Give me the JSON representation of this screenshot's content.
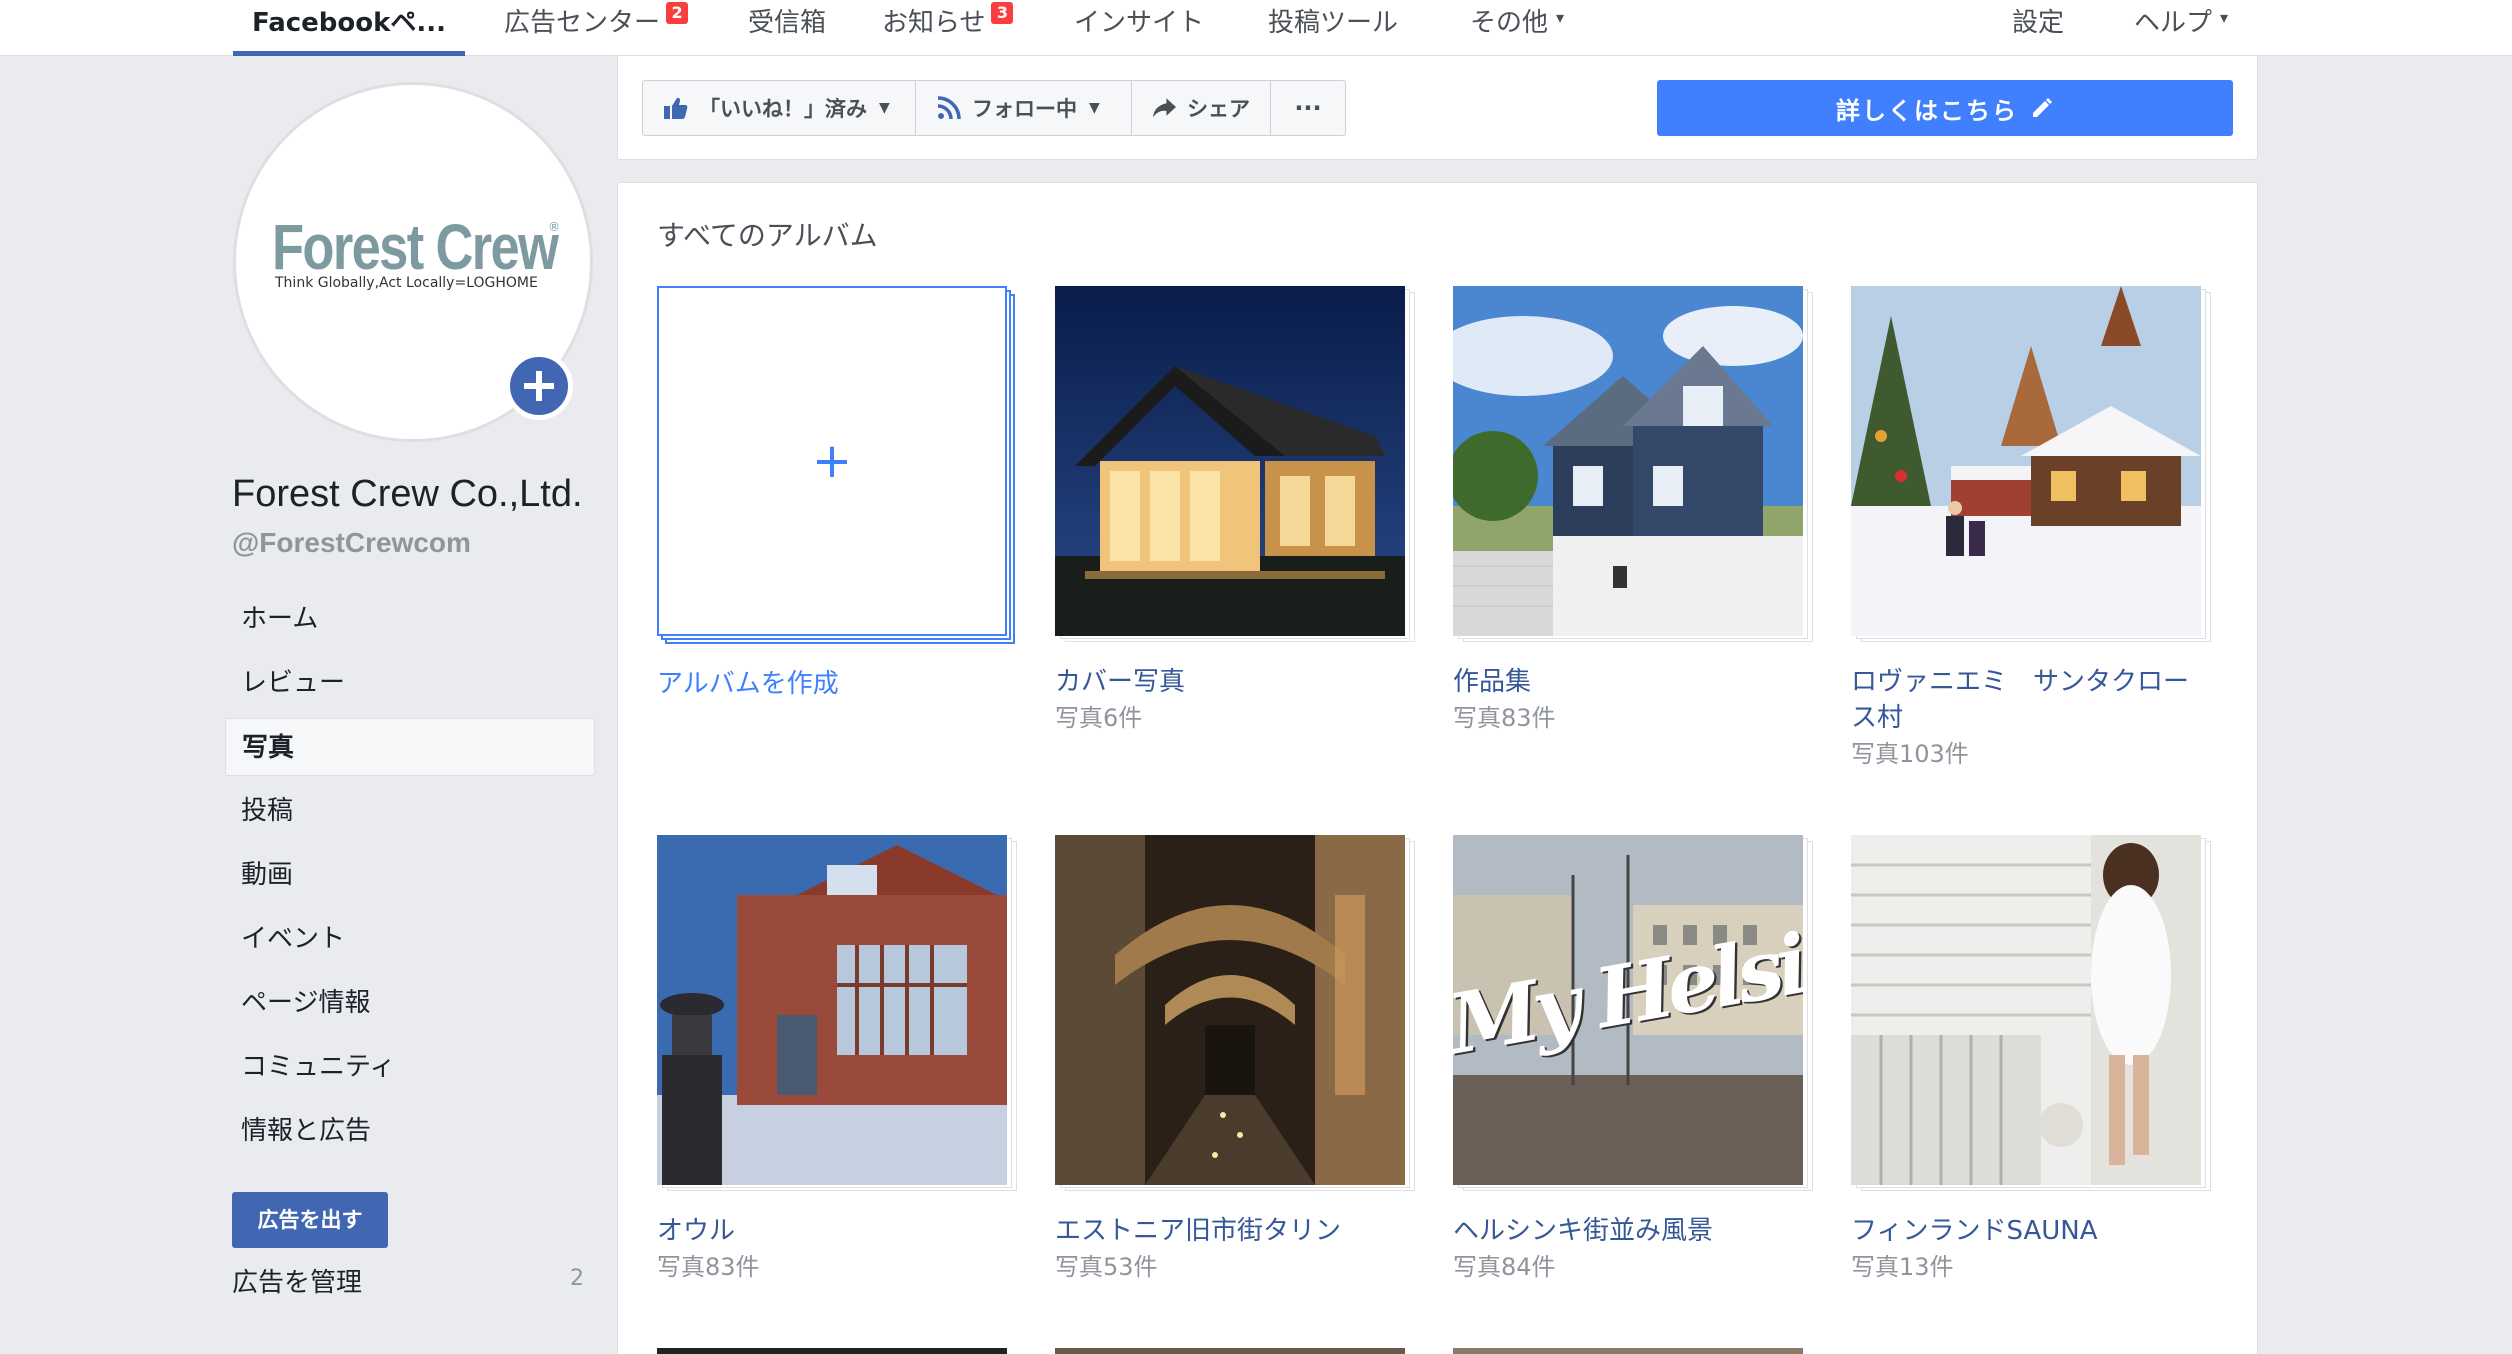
{
  "topnav": {
    "tabs": [
      {
        "label": "Facebookペ...",
        "active": true
      },
      {
        "label": "広告センター",
        "badge": "2"
      },
      {
        "label": "受信箱"
      },
      {
        "label": "お知らせ",
        "badge": "3"
      },
      {
        "label": "インサイト"
      },
      {
        "label": "投稿ツール"
      },
      {
        "label": "その他",
        "caret": "▾"
      },
      {
        "label": "設定"
      },
      {
        "label": "ヘルプ",
        "caret": "▾"
      }
    ]
  },
  "profile": {
    "logo_title": "Forest Crew",
    "logo_reg": "®",
    "logo_sub": "Think Globally,Act Locally=LOGHOME",
    "add_icon": "plus-icon",
    "name": "Forest Crew Co.,Ltd.",
    "handle": "@ForestCrewcom"
  },
  "sidebar": {
    "items": [
      {
        "label": "ホーム"
      },
      {
        "label": "レビュー"
      },
      {
        "label": "写真",
        "active": true
      },
      {
        "label": "投稿"
      },
      {
        "label": "動画"
      },
      {
        "label": "イベント"
      },
      {
        "label": "ページ情報"
      },
      {
        "label": "コミュニティ"
      },
      {
        "label": "情報と広告"
      }
    ],
    "ad_button": "広告を出す",
    "ad_manage": "広告を管理",
    "ad_manage_count": "2"
  },
  "actions": {
    "like": "「いいね！」済み",
    "follow": "フォロー中",
    "share": "シェア",
    "more": "···",
    "learn_more": "詳しくはこちら",
    "icons": [
      "thumbs-up-icon",
      "rss-icon",
      "share-arrow-icon",
      "pencil-icon"
    ]
  },
  "albums": {
    "header": "すべてのアルバム",
    "create_label": "アルバムを作成",
    "create_plus": "+",
    "items": [
      {
        "title": "カバー写真",
        "count": "写真6件"
      },
      {
        "title": "作品集",
        "count": "写真83件"
      },
      {
        "title": "ロヴァニエミ　サンタクロース村",
        "count": "写真103件"
      },
      {
        "title": "オウル",
        "count": "写真83件"
      },
      {
        "title": "エストニア旧市街タリン",
        "count": "写真53件"
      },
      {
        "title": "ヘルシンキ街並み風景",
        "count": "写真84件"
      },
      {
        "title": "フィンランドSAUNA",
        "count": "写真13件"
      }
    ],
    "helsinki_overlay": "My Helsinki"
  },
  "colors": {
    "brand": "#4267b2",
    "cta": "#4080ff",
    "link": "#365899",
    "badge": "#fa3e3e"
  }
}
